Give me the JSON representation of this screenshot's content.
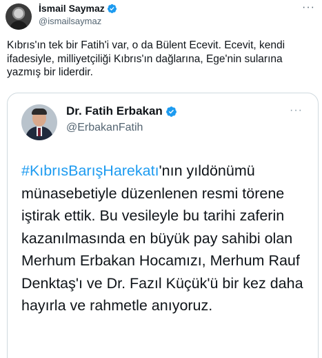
{
  "outer_tweet": {
    "author_name": "İsmail Saymaz",
    "author_handle": "@ismailsaymaz",
    "text": "Kıbrıs'ın tek bir Fatih'i var, o da Bülent Ecevit. Ecevit, kendi ifadesiyle, milliyetçiliği  Kıbrıs'ın dağlarına, Ege'nin sularına yazmış bir liderdir.",
    "more_icon": "···"
  },
  "quoted_tweet": {
    "author_name": "Dr. Fatih Erbakan",
    "author_handle": "@ErbakanFatih",
    "hashtag": "#KıbrısBarışHarekatı",
    "text": "'nın yıldönümü münasebetiyle düzenlenen resmi törene iştirak ettik. Bu vesileyle bu tarihi zaferin kazanılmasında en büyük pay sahibi olan Merhum Erbakan Hocamızı, Merhum Rauf Denktaş'ı ve Dr. Fazıl Küçük'ü bir kez daha hayırla ve rahmetle anıyoruz.",
    "more_icon": "···"
  },
  "colors": {
    "verified_badge": "#1d9bf0",
    "hashtag": "#1d9bf0",
    "secondary_text": "#536471"
  }
}
